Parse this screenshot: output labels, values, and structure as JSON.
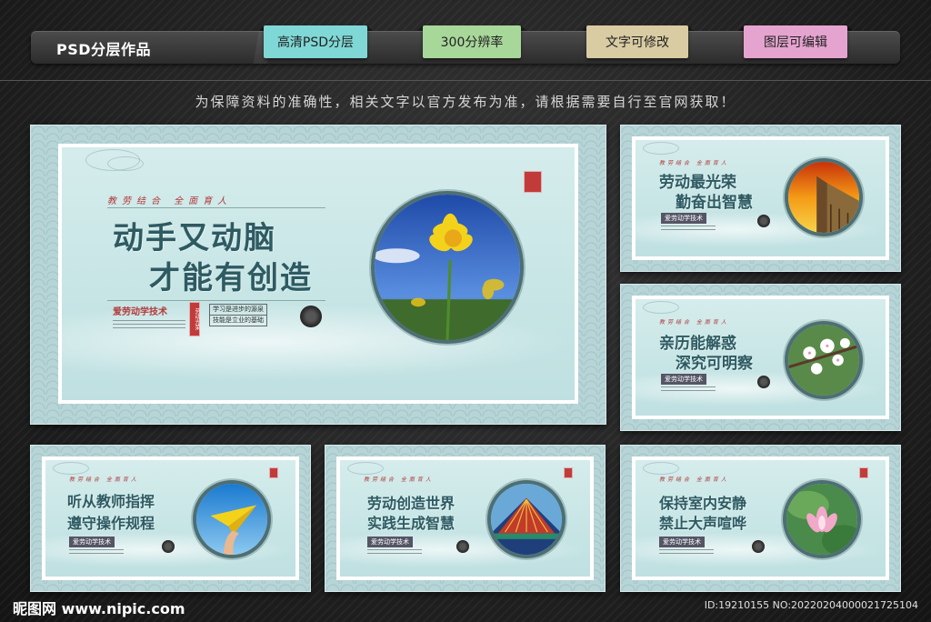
{
  "header": {
    "title": "PSD分层作品",
    "tags": [
      "高清PSD分层",
      "300分辨率",
      "文字可修改",
      "图层可编辑"
    ]
  },
  "notice": "为保障资料的准确性，相关文字以官方发布为准，请根据需要自行至官网获取！",
  "panels": {
    "main": {
      "motto": "教劳结合  全面育人",
      "line1": "动手又动脑",
      "line2": "才能有创造",
      "sub": "爱劳动学技术",
      "box1": "学习是进步的源泉",
      "box2": "技能是立业的基础",
      "stamp": "劳动光荣"
    },
    "p1": {
      "motto": "教劳结合  全面育人",
      "line1": "劳动最光荣",
      "line2": "勤奋出智慧",
      "sub": "爱劳动学技术"
    },
    "p2": {
      "motto": "教劳结合  全面育人",
      "line1": "亲历能解惑",
      "line2": "深究可明察",
      "sub": "爱劳动学技术"
    },
    "p3": {
      "motto": "教劳结合  全面育人",
      "line1": "听从教师指挥",
      "line2": "遵守操作规程",
      "sub": "爱劳动学技术"
    },
    "p4": {
      "motto": "教劳结合  全面育人",
      "line1": "劳动创造世界",
      "line2": "实践生成智慧",
      "sub": "爱劳动学技术"
    },
    "p5": {
      "motto": "教劳结合  全面育人",
      "line1": "保持室内安静",
      "line2": "禁止大声喧哗",
      "sub": "爱劳动学技术"
    }
  },
  "footer": {
    "logo": "昵图网 www.nipic.com",
    "id": "ID:19210155 NO:20220204000021725104"
  }
}
